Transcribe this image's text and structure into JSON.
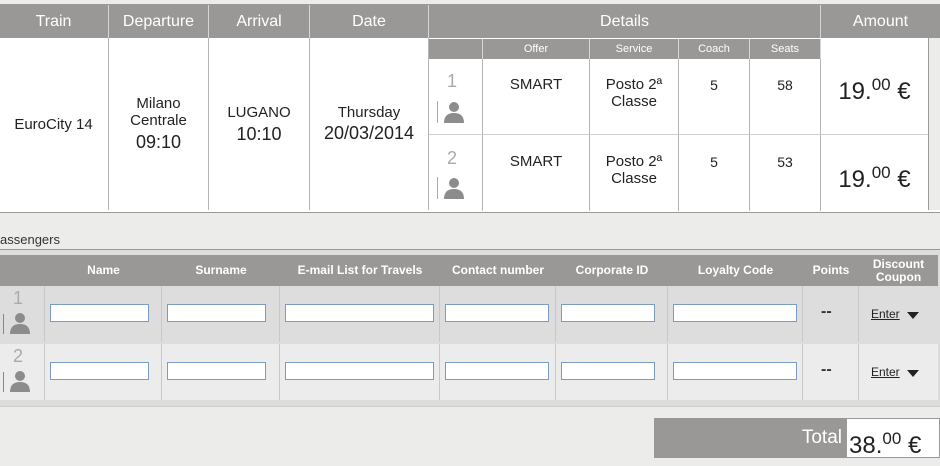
{
  "journey": {
    "headers": {
      "train": "Train",
      "departure": "Departure",
      "arrival": "Arrival",
      "date": "Date",
      "details": "Details",
      "amount": "Amount"
    },
    "detail_headers": {
      "offer": "Offer",
      "service": "Service",
      "coach": "Coach",
      "seats": "Seats"
    },
    "train": "EuroCity  14",
    "departure_station_1": "Milano",
    "departure_station_2": "Centrale",
    "departure_time": "09:10",
    "arrival_station": "LUGANO",
    "arrival_time": "10:10",
    "day": "Thursday",
    "date": "20/03/2014",
    "passengers": [
      {
        "num": "1",
        "offer": "SMART",
        "service_1": "Posto 2ª",
        "service_2": "Classe",
        "coach": "5",
        "seat": "58",
        "amount_int": "19.",
        "amount_dec": "00",
        "currency": "€"
      },
      {
        "num": "2",
        "offer": "SMART",
        "service_1": "Posto 2ª",
        "service_2": "Classe",
        "coach": "5",
        "seat": "53",
        "amount_int": "19.",
        "amount_dec": "00",
        "currency": "€"
      }
    ]
  },
  "passengers_section": {
    "label": "assengers",
    "headers": {
      "name": "Name",
      "surname": "Surname",
      "email": "E-mail List for Travels",
      "contact": "Contact number",
      "corporate": "Corporate ID",
      "loyalty": "Loyalty Code",
      "points": "Points",
      "discount_1": "Discount",
      "discount_2": "Coupon"
    },
    "rows": [
      {
        "num": "1",
        "points": "--",
        "enter": "Enter"
      },
      {
        "num": "2",
        "points": "--",
        "enter": "Enter"
      }
    ]
  },
  "total": {
    "label": "Total",
    "amount_int": "38.",
    "amount_dec": "00",
    "currency": "€"
  },
  "icons": {
    "person": "person-icon",
    "dropdown": "triangle-down-icon"
  },
  "colors": {
    "header_bg": "#999897",
    "page_bg": "#ececea",
    "input_border": "#7a9cc0"
  }
}
